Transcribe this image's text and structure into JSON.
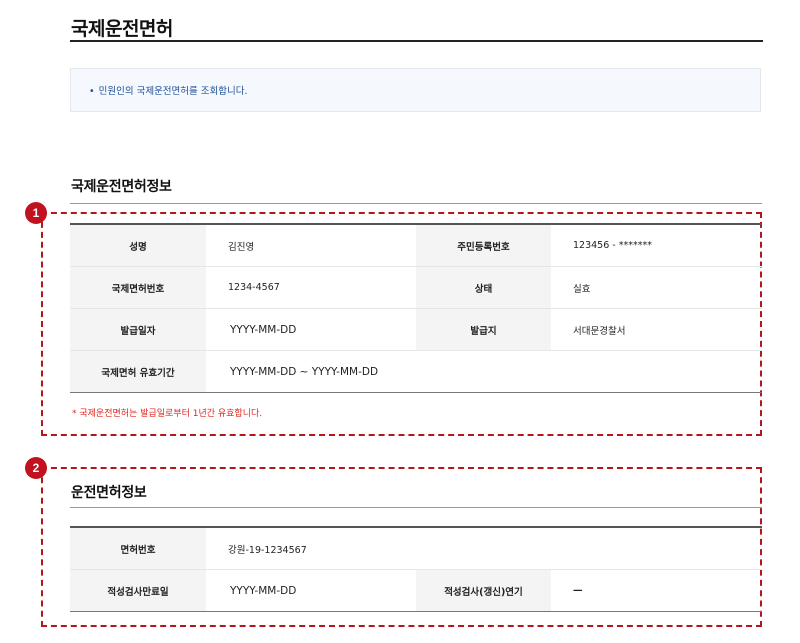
{
  "page": {
    "title": "국제운전면허",
    "notice": "민원인의 국제운전면허를 조회합니다."
  },
  "sections": [
    {
      "title": "국제운전면허정보",
      "badge": "1",
      "rows": [
        [
          {
            "label": "성명",
            "value": "김진영"
          },
          {
            "label": "주민등록번호",
            "value": "123456 - *******"
          }
        ],
        [
          {
            "label": "국제면허번호",
            "value": "1234-4567"
          },
          {
            "label": "상태",
            "value": "실효"
          }
        ],
        [
          {
            "label": "발급일자",
            "value": "YYYY-MM-DD"
          },
          {
            "label": "발급지",
            "value": "서대문경찰서"
          }
        ],
        [
          {
            "label": "국제면허 유효기간",
            "value": "YYYY-MM-DD ~ YYYY-MM-DD"
          }
        ]
      ],
      "caution": "* 국제운전면허는 발급일로부터 1년간 유효합니다."
    },
    {
      "title": "운전면허정보",
      "badge": "2",
      "rows": [
        [
          {
            "label": "면허번호",
            "value": "강원-19-1234567"
          }
        ],
        [
          {
            "label": "적성검사만료일",
            "value": "YYYY-MM-DD"
          },
          {
            "label": "적성검사(갱신)연기",
            "value": "—"
          }
        ]
      ]
    }
  ],
  "colors": {
    "highlight": "#b4161b",
    "notice_text": "#1f4f9a",
    "caution_text": "#e0261f"
  }
}
